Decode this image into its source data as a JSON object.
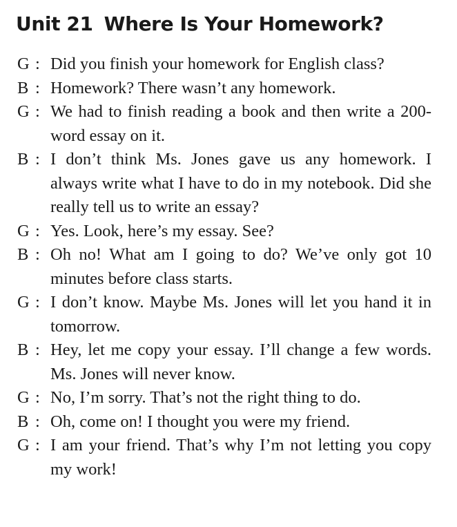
{
  "title": {
    "unit": "Unit 21",
    "name": "Where Is Your Homework?"
  },
  "dialogue": [
    {
      "speaker": "G",
      "colon": ":",
      "text": "Did you finish your homework for English class?"
    },
    {
      "speaker": "B",
      "colon": ":",
      "text": "Homework? There wasn’t any homework."
    },
    {
      "speaker": "G",
      "colon": ":",
      "text": "We had to finish reading a book and then write a 200-word essay on it."
    },
    {
      "speaker": "B",
      "colon": ":",
      "text": "I don’t think Ms. Jones gave us any homework. I always write what I have to do in my notebook. Did she really tell us to write an essay?"
    },
    {
      "speaker": "G",
      "colon": ":",
      "text": "Yes. Look, here’s my essay. See?"
    },
    {
      "speaker": "B",
      "colon": ":",
      "text": "Oh no! What am I going to do? We’ve only got 10 minutes before class starts."
    },
    {
      "speaker": "G",
      "colon": ":",
      "text": "I don’t know. Maybe Ms. Jones will let you hand it in tomorrow."
    },
    {
      "speaker": "B",
      "colon": ":",
      "text": "Hey, let me copy your essay. I’ll change a few words. Ms. Jones will never know."
    },
    {
      "speaker": "G",
      "colon": ":",
      "text": "No, I’m sorry. That’s not the right thing to do."
    },
    {
      "speaker": "B",
      "colon": ":",
      "text": "Oh, come on! I thought you were my friend."
    },
    {
      "speaker": "G",
      "colon": ":",
      "text": "I am your friend. That’s why I’m not letting you copy my work!"
    }
  ]
}
